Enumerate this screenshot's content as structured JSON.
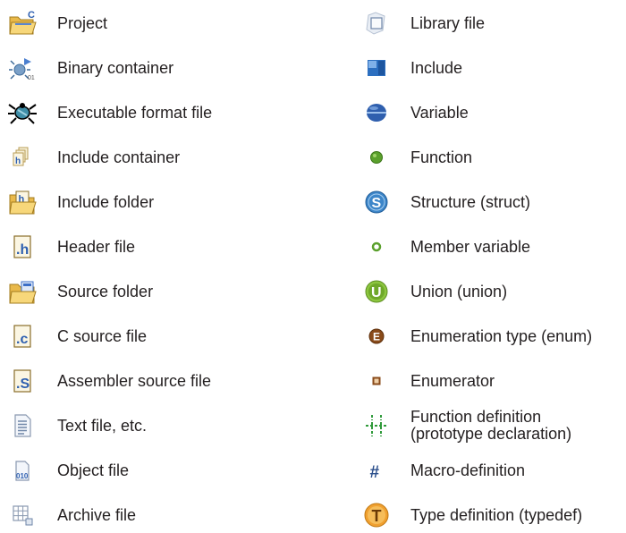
{
  "left_column": [
    {
      "label": "Project",
      "icon": "project-icon"
    },
    {
      "label": "Binary container",
      "icon": "binary-container-icon"
    },
    {
      "label": "Executable format file",
      "icon": "executable-file-icon"
    },
    {
      "label": "Include container",
      "icon": "include-container-icon"
    },
    {
      "label": "Include folder",
      "icon": "include-folder-icon"
    },
    {
      "label": "Header file",
      "icon": "header-file-icon"
    },
    {
      "label": "Source folder",
      "icon": "source-folder-icon"
    },
    {
      "label": "C source file",
      "icon": "c-source-file-icon"
    },
    {
      "label": "Assembler source file",
      "icon": "assembler-source-file-icon"
    },
    {
      "label": "Text file, etc.",
      "icon": "text-file-icon"
    },
    {
      "label": "Object file",
      "icon": "object-file-icon"
    },
    {
      "label": "Archive file",
      "icon": "archive-file-icon"
    }
  ],
  "right_column": [
    {
      "label": "Library file",
      "icon": "library-file-icon"
    },
    {
      "label": "Include",
      "icon": "include-icon"
    },
    {
      "label": "Variable",
      "icon": "variable-icon"
    },
    {
      "label": "Function",
      "icon": "function-icon"
    },
    {
      "label": "Structure (struct)",
      "icon": "structure-icon"
    },
    {
      "label": "Member variable",
      "icon": "member-variable-icon"
    },
    {
      "label": "Union (union)",
      "icon": "union-icon"
    },
    {
      "label": "Enumeration type (enum)",
      "icon": "enumeration-type-icon"
    },
    {
      "label": "Enumerator",
      "icon": "enumerator-icon"
    },
    {
      "label": "Function definition",
      "label_line2": "(prototype declaration)",
      "icon": "function-definition-icon"
    },
    {
      "label": "Macro-definition",
      "icon": "macro-definition-icon"
    },
    {
      "label": "Type definition (typedef)",
      "icon": "type-definition-icon"
    }
  ],
  "colors": {
    "text": "#231f20",
    "folder_yellow": "#f2c45a",
    "folder_blue": "#3c6fc7",
    "variable_blue": "#2f5fae",
    "function_green": "#5aa02c",
    "struct_blue": "#3d86c9",
    "union_green": "#8cc63f",
    "enum_brown": "#8a4b1a",
    "typedef_orange": "#f0a030",
    "macro_blue": "#2b4f8c"
  }
}
